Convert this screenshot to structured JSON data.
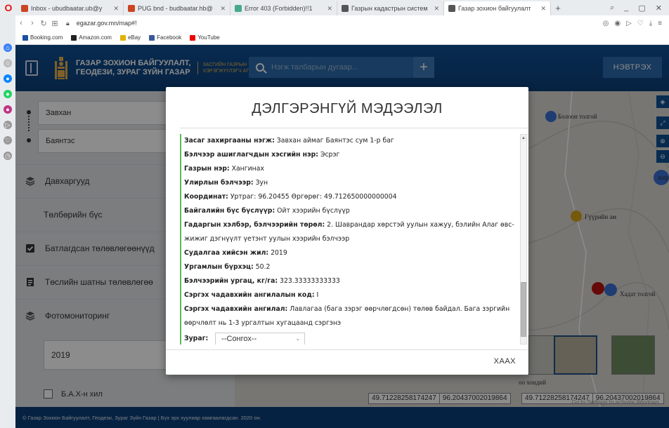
{
  "browser": {
    "tabs": [
      {
        "label": "Inbox - ubudbaatar.ub@y",
        "color": "#c42"
      },
      {
        "label": "PUG bnd - budbaatar.hb@",
        "color": "#c42"
      },
      {
        "label": "Error 403 (Forbidden)!!1",
        "color": "#4a8"
      },
      {
        "label": "Газрын кадастрын систем",
        "color": "#555"
      },
      {
        "label": "Газар зохион байгуулалт",
        "color": "#555"
      }
    ],
    "new_tab": "+",
    "url": "egazar.gov.mn/map#!",
    "bookmarks": [
      {
        "label": "Booking.com",
        "color": "#1b4fa0"
      },
      {
        "label": "Amazon.com",
        "color": "#222"
      },
      {
        "label": "eBay",
        "color": "#e4b000"
      },
      {
        "label": "Facebook",
        "color": "#3b5998"
      },
      {
        "label": "YouTube",
        "color": "#e00"
      }
    ]
  },
  "header": {
    "org_line1": "ГАЗАР ЗОХИОН БАЙГУУЛАЛТ,",
    "org_line2": "ГЕОДЕЗИ, ЗУРАГ ЗҮЙН ГАЗАР",
    "org_sub1": "ЗАСГИЙН ГАЗРЫН",
    "org_sub2": "ХЭРЭГЖҮҮЛЭГЧ АГЕНТЛАГ",
    "search_placeholder": "Нэгж талбарын дугаар...",
    "add_label": "+",
    "login_label": "НЭВТРЭХ"
  },
  "sidebar": {
    "aimag": "Завхан",
    "sum": "Баянтэс",
    "items": [
      {
        "label": "Давхаргууд",
        "icon": "layers-icon"
      },
      {
        "label": "Төлбөрийн бүс",
        "icon": ""
      },
      {
        "label": "Батлагдсан төлөвлөгөөнүүд",
        "icon": "check-square-icon"
      },
      {
        "label": "Төслийн шатны төлөвлөгөө",
        "icon": "document-icon"
      },
      {
        "label": "Фотомониторинг",
        "icon": "layers-icon"
      }
    ],
    "year": "2019",
    "checkbox_label": "Б.А.Х-н хил"
  },
  "map": {
    "labels": [
      "Болоон толгой",
      "Гүүрийн ам",
      "Хадат толгой",
      "жир",
      "оо хондий",
      "оо"
    ],
    "coords_left": [
      "49.71228258174247",
      "96.20437002019864"
    ],
    "coords_right": [
      "49.71228258174247",
      "96.20437002019864"
    ],
    "watermark": "Go to Settings to activate Windows."
  },
  "footer": {
    "text": "© Газар Зохион Байгуулалт, Геодези, Зураг Зүйн Газар | Бүх эрх хуулиар хамгаалагдсан. 2020 он."
  },
  "modal": {
    "title": "ДЭЛГЭРЭНГҮЙ МЭДЭЭЛЭЛ",
    "rows": [
      {
        "label": "Засаг захиргааны нэгж:",
        "value": " Завхан аймаг Баянтэс сум 1-р баг"
      },
      {
        "label": "Бэлчээр ашиглагчдын хэсгийн нэр:",
        "value": " Эсрэг"
      },
      {
        "label": "Газрын нэр:",
        "value": " Хангинах"
      },
      {
        "label": "Улирлын бэлчээр:",
        "value": " Зун"
      },
      {
        "label": "Координат:",
        "value": " Уртраг: 96.20455 Өргөрөг: 49.712650000000004"
      },
      {
        "label": "Байгалийн бүс бүслүүр:",
        "value": " Ойт хээрийн бүслүүр"
      },
      {
        "label": "Гадаргын хэлбэр, бэлчээрийн төрөл:",
        "value": " 2. Шаврандар хөрстэй уулын хажуу, бэлийн Алаг өвс-жижиг дэгнүүлт үетэнт уулын хээрийн бэлчээр"
      },
      {
        "label": "Судалгаа хийсэн жил:",
        "value": " 2019"
      },
      {
        "label": "Ургамлын бүрхэц:",
        "value": " 50.2"
      },
      {
        "label": "Бэлчээрийн ургац, кг/га:",
        "value": " 323.33333333333"
      },
      {
        "label": "Сэргэх чадавхийн ангилалын код:",
        "value": " I"
      },
      {
        "label": "Сэргэх чадавхийн ангилал:",
        "value": " Лавлагаа (бага зэрэг өөрчлөгдсөн) төлөв байдал. Бага зэргийн өөрчлөлт нь 1-3 ургалтын хугацаанд сэргэнэ"
      }
    ],
    "zurag_label": "Зураг:",
    "zurag_value": "--Сонгох--",
    "close_label": "ХААХ"
  },
  "colors": {
    "header_blue": "#0f4f93",
    "gold": "#e9b04c",
    "accent_green": "#5cb85c"
  }
}
